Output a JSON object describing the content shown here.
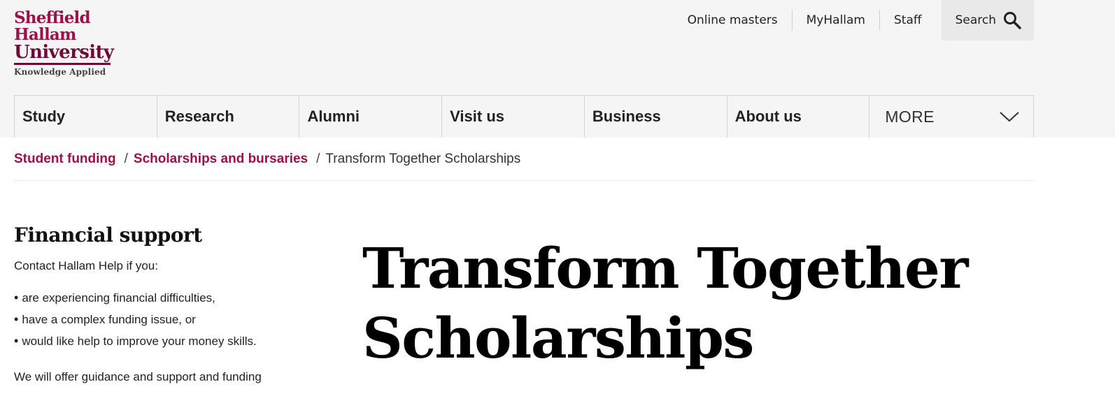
{
  "logo": {
    "line1": "Sheffield",
    "line2": "Hallam",
    "line3": "University",
    "tagline": "Knowledge Applied"
  },
  "utility_nav": {
    "items": [
      "Online masters",
      "MyHallam",
      "Staff"
    ],
    "search_label": "Search"
  },
  "main_nav": {
    "items": [
      "Study",
      "Research",
      "Alumni",
      "Visit us",
      "Business",
      "About us"
    ],
    "more_label": "MORE"
  },
  "breadcrumb": {
    "links": [
      "Student funding",
      "Scholarships and bursaries"
    ],
    "separator": "/",
    "current": "Transform Together Scholarships"
  },
  "sidebar": {
    "title": "Financial support",
    "intro": "Contact Hallam Help if you:",
    "bullets": [
      "are experiencing financial difficulties,",
      "have a complex funding issue, or",
      "would like help to improve your money skills."
    ],
    "more_text": "We will offer guidance and support and funding"
  },
  "page": {
    "title_line1": "Transform Together",
    "title_line2": "Scholarships"
  },
  "colors": {
    "brand": "#9d1048",
    "brand_dark": "#6f0b35",
    "header_bg": "#f5f5f5"
  }
}
